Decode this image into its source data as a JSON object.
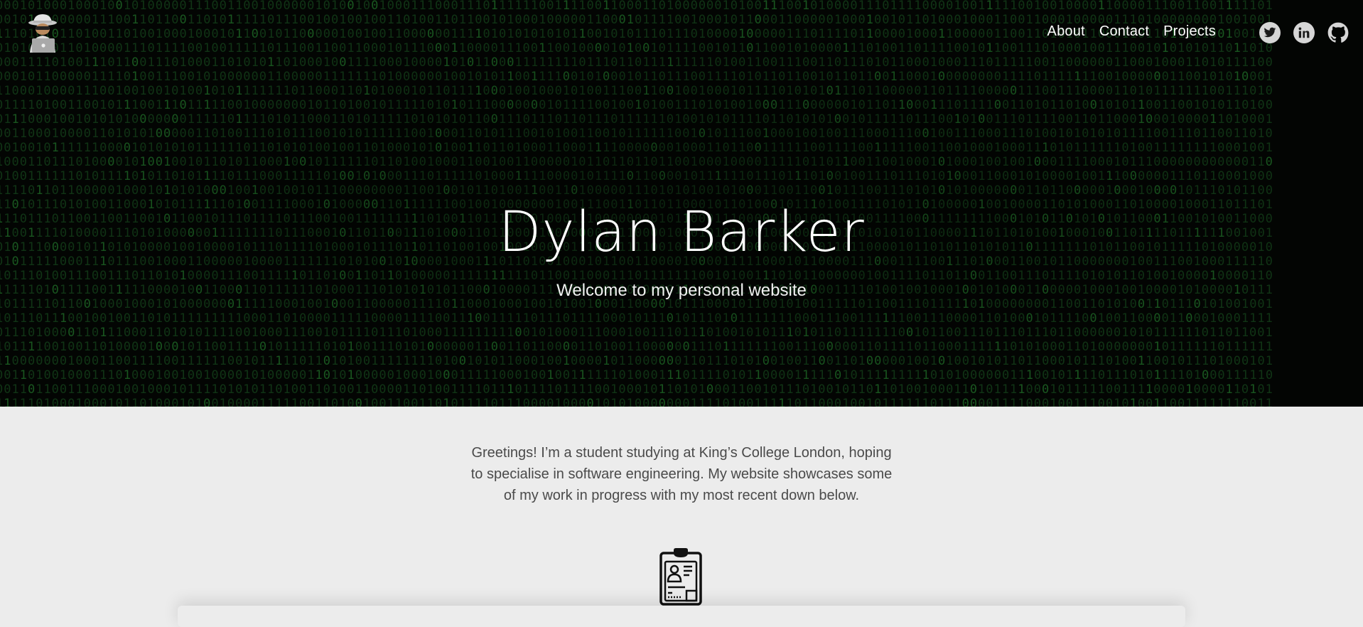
{
  "nav": {
    "about": "About",
    "contact": "Contact",
    "projects": "Projects"
  },
  "social": {
    "icons": [
      "twitter-icon",
      "linkedin-icon",
      "github-icon"
    ]
  },
  "hero": {
    "title": "Dylan Barker",
    "subtitle": "Welcome to my personal website"
  },
  "intro": {
    "text": "Greetings! I’m a student studying at King’s College London, hoping to specialise in software engineering. My website showcases some of my work in progress with my most recent down below."
  },
  "colors": {
    "hero_background": "#030503",
    "matrix_green": "#14401a",
    "page_background": "#ececec",
    "body_text": "#4a4a4a",
    "nav_text": "#ffffff",
    "social_circle": "#d6d6d6"
  }
}
